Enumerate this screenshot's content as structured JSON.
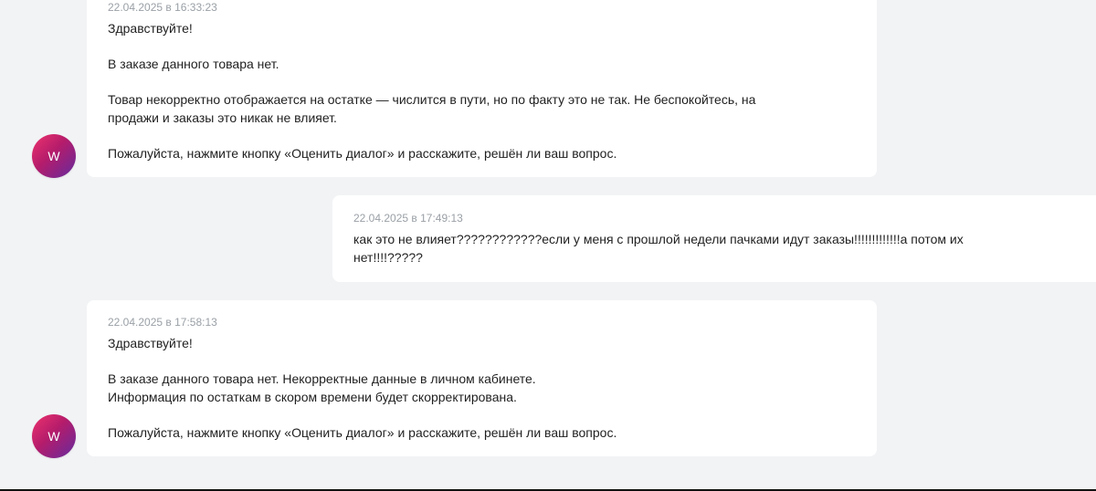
{
  "conversation": {
    "messages": [
      {
        "sender": "W",
        "timestamp": "22.04.2025 в 16:33:23",
        "lines": [
          "Здравствуйте!",
          "",
          "В заказе данного товара нет.",
          "",
          "Товар некорректно отображается на остатке — числится в пути, но по факту это не так. Не беспокойтесь, на",
          "продажи и заказы это никак не влияет.",
          "",
          "Пожалуйста, нажмите кнопку «Оценить диалог» и расскажите, решён ли ваш вопрос."
        ]
      },
      {
        "timestamp": "22.04.2025 в 17:49:13",
        "lines": [
          "как это не влияет????????????если у меня с прошлой недели пачками идут заказы!!!!!!!!!!!!!а потом их",
          "нет!!!!?????"
        ]
      },
      {
        "sender": "W",
        "timestamp": "22.04.2025 в 17:58:13",
        "lines": [
          "Здравствуйте!",
          "",
          "В заказе данного товара нет. Некорректные данные в личном кабинете.",
          "Информация по остаткам в скором времени будет скорректирована.",
          "",
          "Пожалуйста, нажмите кнопку «Оценить диалог» и расскажите, решён ли ваш вопрос."
        ]
      }
    ]
  },
  "colors": {
    "background": "#f2f3f5",
    "bubble": "#ffffff",
    "timestamp": "#9aa0a6",
    "text": "#1f1f1f",
    "avatar_gradient_start": "#ef326d",
    "avatar_gradient_end": "#642b9f"
  },
  "icons": {
    "avatar": "avatar-circle"
  }
}
